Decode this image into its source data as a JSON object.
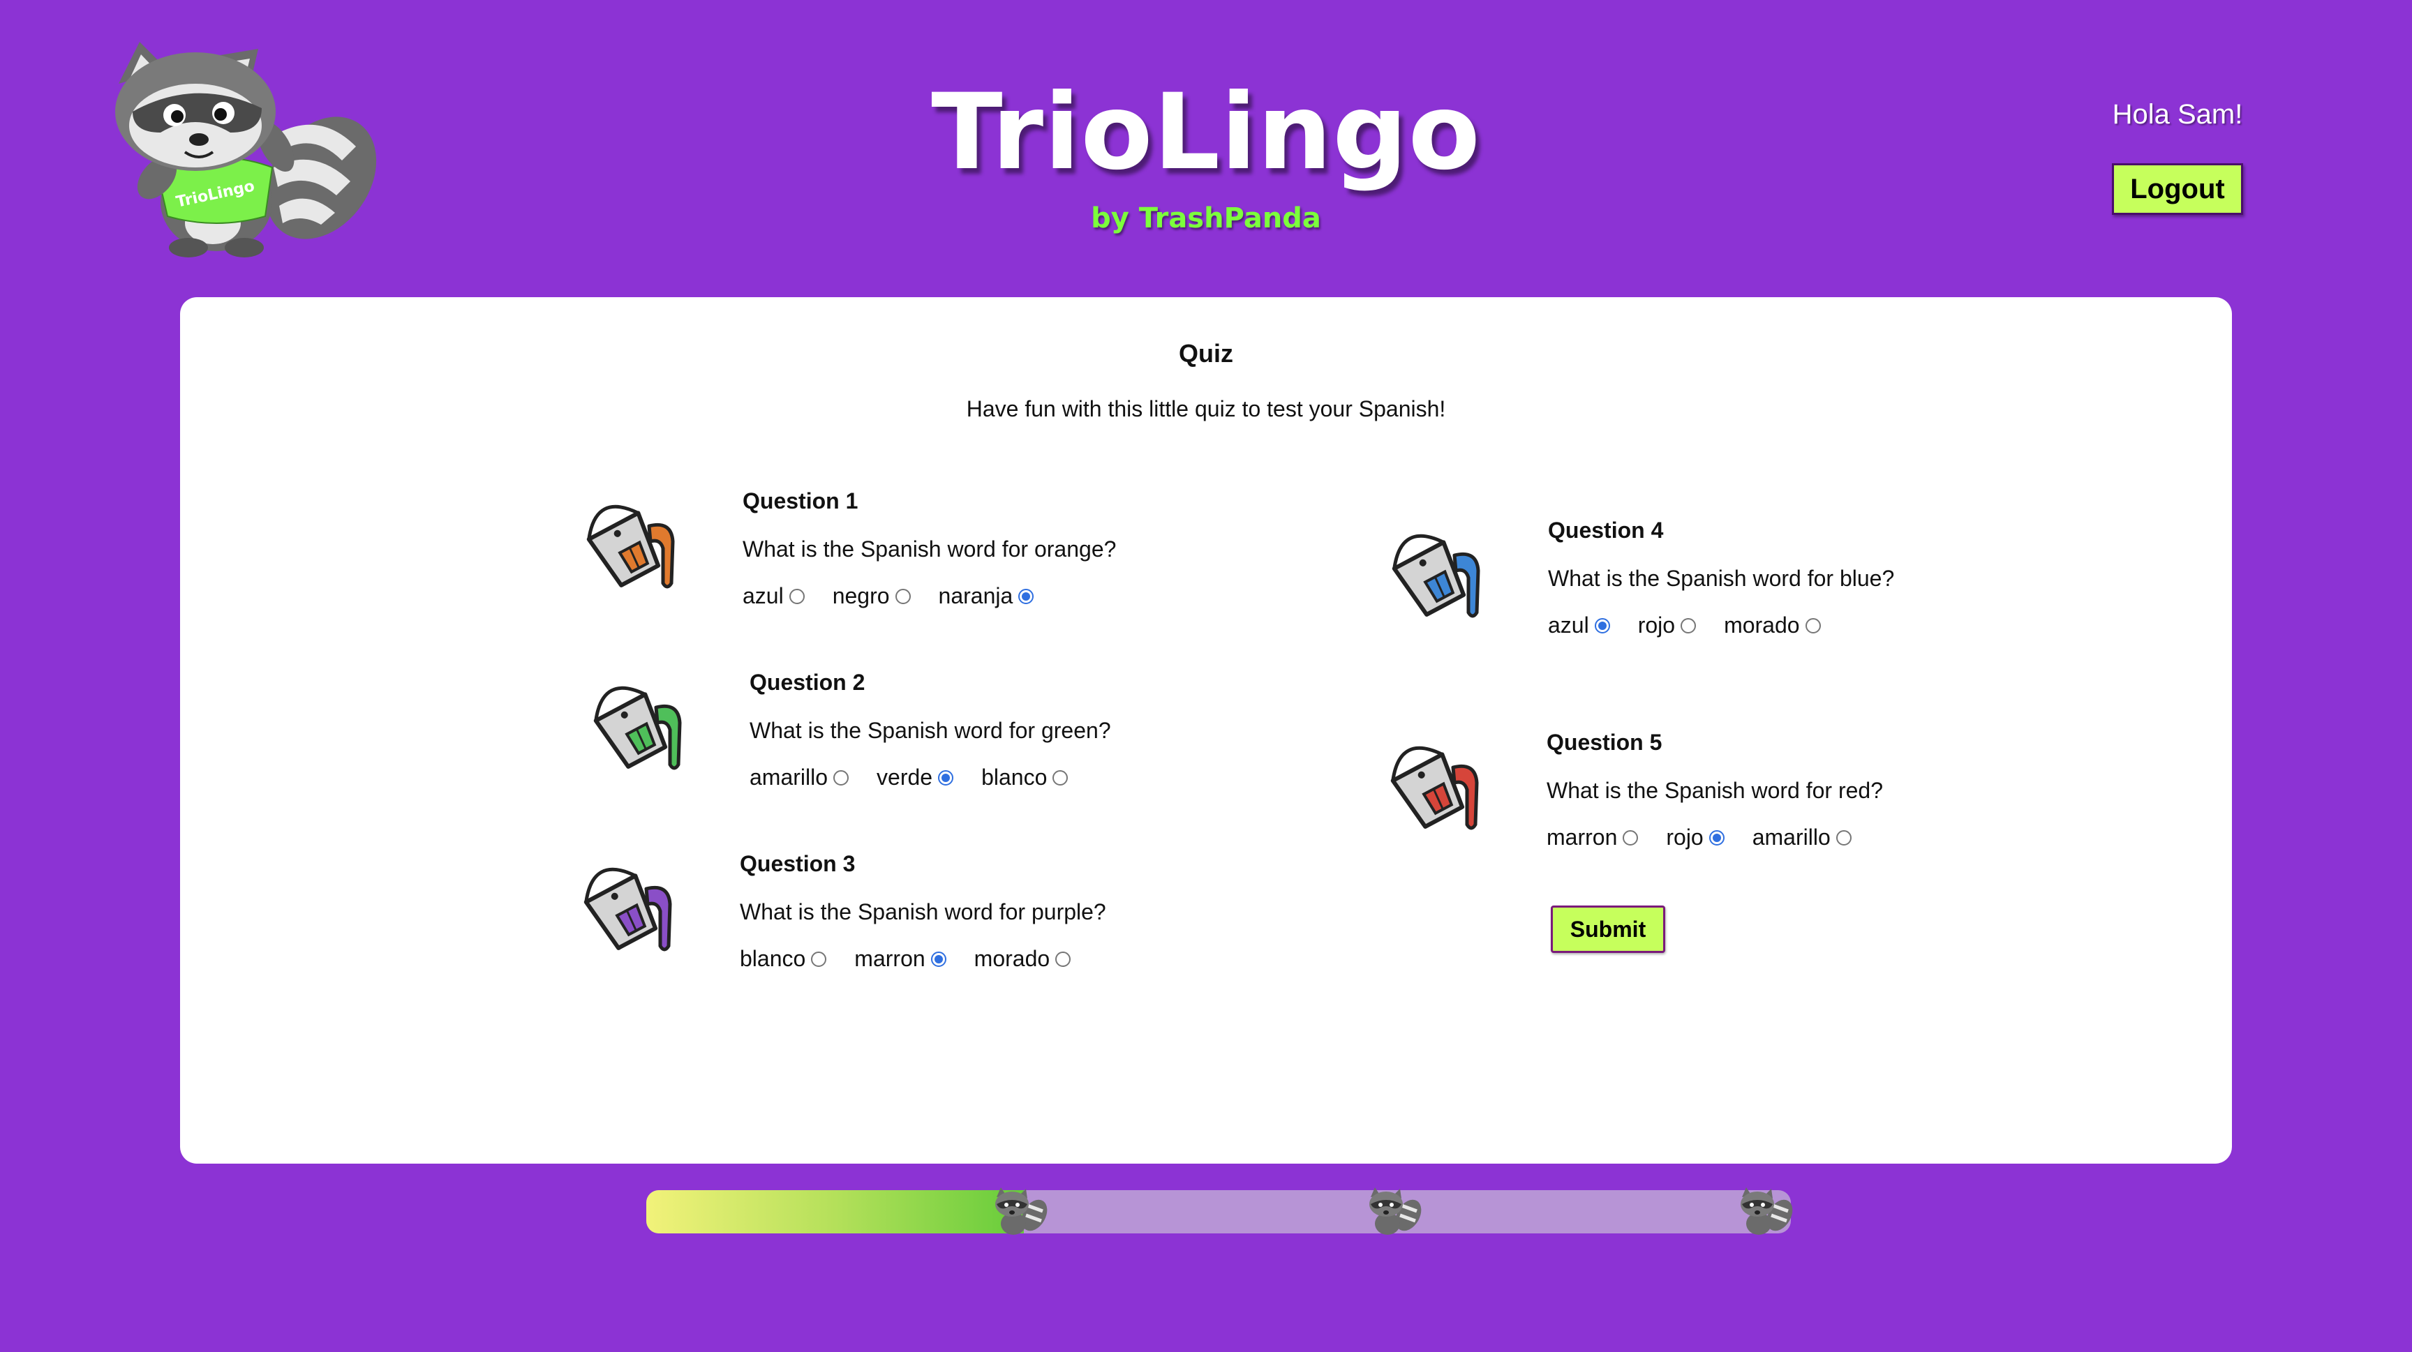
{
  "header": {
    "title": "TrioLingo",
    "subtitle": "by TrashPanda",
    "greeting": "Hola Sam!",
    "logout_label": "Logout",
    "mascot_shirt_text": "TrioLingo"
  },
  "quiz": {
    "title": "Quiz",
    "intro": "Have fun with this little quiz to test your Spanish!",
    "submit_label": "Submit",
    "questions": [
      {
        "label": "Question 1",
        "prompt": "What is the Spanish word for orange?",
        "paint_color": "#e07a2e",
        "options": [
          {
            "text": "azul",
            "selected": false
          },
          {
            "text": "negro",
            "selected": false
          },
          {
            "text": "naranja",
            "selected": true
          }
        ]
      },
      {
        "label": "Question 2",
        "prompt": "What is the Spanish word for green?",
        "paint_color": "#4fbf5a",
        "options": [
          {
            "text": "amarillo",
            "selected": false
          },
          {
            "text": "verde",
            "selected": true
          },
          {
            "text": "blanco",
            "selected": false
          }
        ]
      },
      {
        "label": "Question 3",
        "prompt": "What is the Spanish word for purple?",
        "paint_color": "#8a4fc7",
        "options": [
          {
            "text": "blanco",
            "selected": false
          },
          {
            "text": "marron",
            "selected": true
          },
          {
            "text": "morado",
            "selected": false
          }
        ]
      },
      {
        "label": "Question 4",
        "prompt": "What is the Spanish word for blue?",
        "paint_color": "#3d86d6",
        "options": [
          {
            "text": "azul",
            "selected": true
          },
          {
            "text": "rojo",
            "selected": false
          },
          {
            "text": "morado",
            "selected": false
          }
        ]
      },
      {
        "label": "Question 5",
        "prompt": "What is the Spanish word for red?",
        "paint_color": "#d6453a",
        "options": [
          {
            "text": "marron",
            "selected": false
          },
          {
            "text": "rojo",
            "selected": true
          },
          {
            "text": "amarillo",
            "selected": false
          }
        ]
      }
    ]
  },
  "progress": {
    "fraction": 0.33,
    "marker_count": 3
  },
  "colors": {
    "background": "#8c33d4",
    "button": "#c6ff5c",
    "subtitle": "#7cff3c",
    "radio_checked": "#2f6fe0"
  }
}
